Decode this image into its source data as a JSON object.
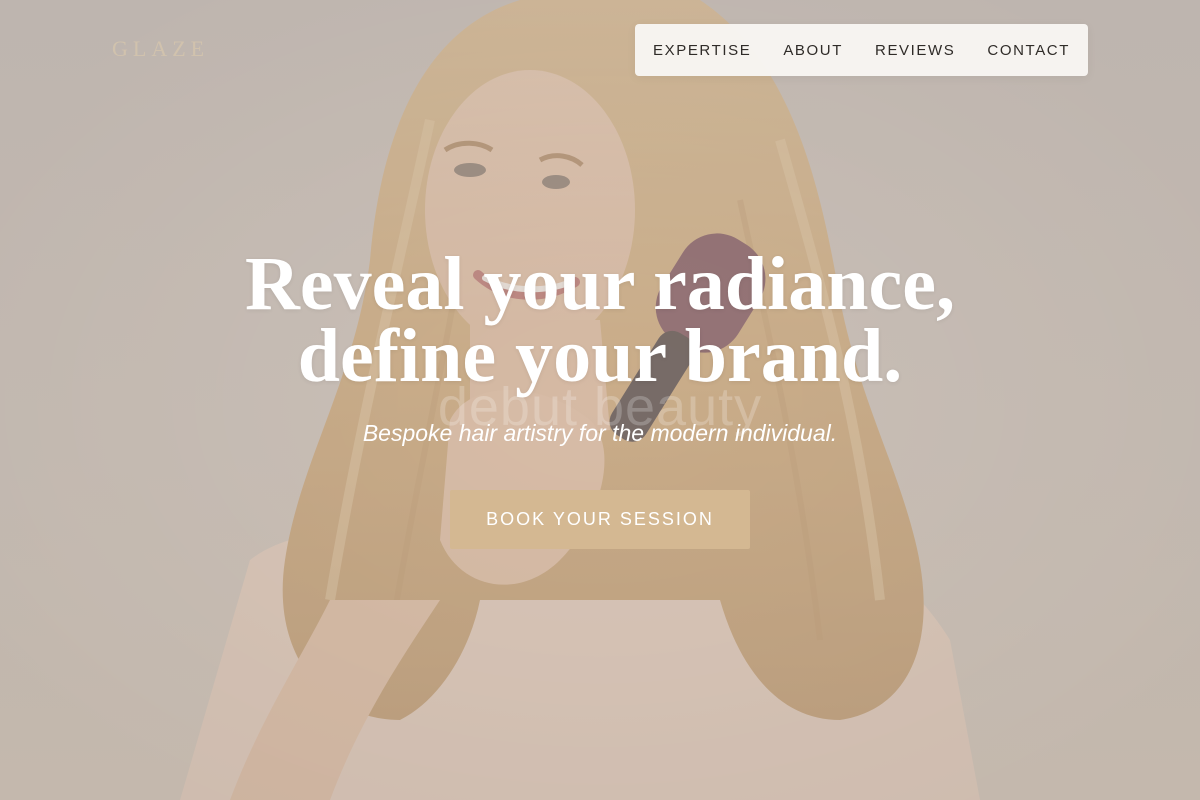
{
  "brand": {
    "logo_text": "GLAZE"
  },
  "nav": {
    "items": [
      {
        "label": "EXPERTISE"
      },
      {
        "label": "ABOUT"
      },
      {
        "label": "REVIEWS"
      },
      {
        "label": "CONTACT"
      }
    ]
  },
  "hero": {
    "headline_line1": "Reveal your radiance,",
    "headline_line2": "define your brand.",
    "ghost_text": "debut beauty",
    "subtitle": "Bespoke hair artistry for the modern individual.",
    "cta_label": "BOOK YOUR SESSION",
    "image": "woman-with-blonde-hair-holding-brush"
  },
  "colors": {
    "accent": "#d4b892",
    "nav_background": "#f8f6f3",
    "nav_text": "#2f2b28",
    "headline": "#ffffff",
    "page_background": "#c9bfb6"
  }
}
